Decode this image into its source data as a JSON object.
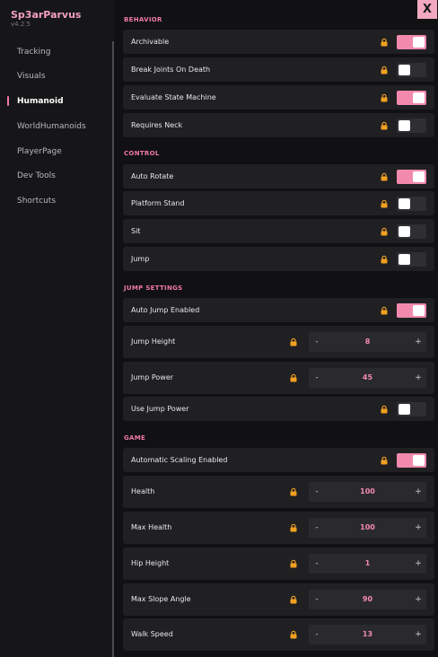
{
  "app": {
    "title": "Sp3arParvus",
    "version": "v4.2.5",
    "close_label": "X"
  },
  "sidebar": {
    "items": [
      {
        "label": "Tracking"
      },
      {
        "label": "Visuals"
      },
      {
        "label": "Humanoid",
        "active": true
      },
      {
        "label": "WorldHumanoids"
      },
      {
        "label": "PlayerPage"
      },
      {
        "label": "Dev Tools"
      },
      {
        "label": "Shortcuts"
      }
    ]
  },
  "sections": {
    "behavior": {
      "title": "BEHAVIOR",
      "archivable": {
        "label": "Archivable",
        "value": true
      },
      "break_joints": {
        "label": "Break Joints On Death",
        "value": false
      },
      "evaluate_state": {
        "label": "Evaluate State Machine",
        "value": true
      },
      "requires_neck": {
        "label": "Requires Neck",
        "value": false
      }
    },
    "control": {
      "title": "CONTROL",
      "auto_rotate": {
        "label": "Auto Rotate",
        "value": true
      },
      "platform_stand": {
        "label": "Platform Stand",
        "value": false
      },
      "sit": {
        "label": "Sit",
        "value": false
      },
      "jump": {
        "label": "Jump",
        "value": false
      }
    },
    "jump_settings": {
      "title": "JUMP SETTINGS",
      "auto_jump": {
        "label": "Auto Jump Enabled",
        "value": true
      },
      "jump_height": {
        "label": "Jump Height",
        "value": "8"
      },
      "jump_power": {
        "label": "Jump Power",
        "value": "45"
      },
      "use_jump_power": {
        "label": "Use Jump Power",
        "value": false
      }
    },
    "game": {
      "title": "GAME",
      "auto_scaling": {
        "label": "Automatic Scaling Enabled",
        "value": true
      },
      "health": {
        "label": "Health",
        "value": "100"
      },
      "max_health": {
        "label": "Max Health",
        "value": "100"
      },
      "hip_height": {
        "label": "Hip Height",
        "value": "1"
      },
      "max_slope": {
        "label": "Max Slope Angle",
        "value": "90"
      },
      "walk_speed": {
        "label": "Walk Speed",
        "value": "13"
      }
    }
  },
  "stepper": {
    "minus": "-",
    "plus": "+"
  },
  "colors": {
    "accent": "#f07aa3",
    "toggle_on": "#f28aad",
    "lock": "#f0a020"
  },
  "icons": {
    "lock": "lock-icon",
    "close": "close-icon"
  }
}
